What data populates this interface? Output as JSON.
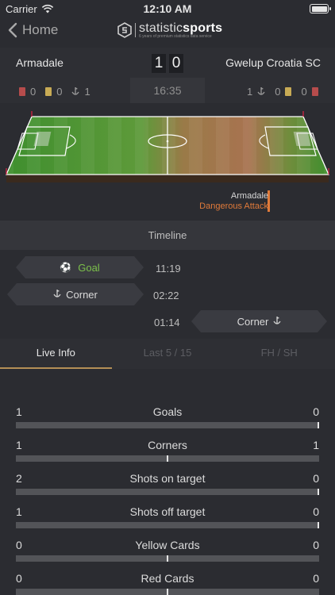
{
  "status": {
    "carrier": "Carrier",
    "time": "12:10 AM"
  },
  "nav": {
    "back_label": "Home",
    "brand_light": "statistic",
    "brand_bold": "sports",
    "tagline": "6 years of premium statistics data service"
  },
  "match": {
    "home_team": "Armadale",
    "away_team": "Gwelup Croatia SC",
    "home_score": "1",
    "away_score": "0",
    "clock": "16:35",
    "home_counts": {
      "red": "0",
      "yellow": "0",
      "corners": "1"
    },
    "away_counts": {
      "corners": "1",
      "yellow": "0",
      "red": "0"
    }
  },
  "event": {
    "team": "Armadale",
    "desc": "Dangerous Attack"
  },
  "timeline": {
    "header": "Timeline",
    "items": [
      {
        "label": "Goal",
        "time": "11:19"
      },
      {
        "label": "Corner",
        "time": "02:22"
      },
      {
        "label": "Corner",
        "time": "01:14"
      }
    ]
  },
  "tabs": [
    "Live Info",
    "Last 5 / 15",
    "FH / SH"
  ],
  "stats": [
    {
      "name": "Goals",
      "home": "1",
      "away": "0",
      "home_share": 1.0
    },
    {
      "name": "Corners",
      "home": "1",
      "away": "1",
      "home_share": 0.5
    },
    {
      "name": "Shots on target",
      "home": "2",
      "away": "0",
      "home_share": 1.0
    },
    {
      "name": "Shots off target",
      "home": "1",
      "away": "0",
      "home_share": 1.0
    },
    {
      "name": "Yellow Cards",
      "home": "0",
      "away": "0",
      "home_share": 0.5
    },
    {
      "name": "Red Cards",
      "home": "0",
      "away": "0",
      "home_share": 0.5
    }
  ],
  "colors": {
    "accent": "#b48f56",
    "attack": "#e07a3a",
    "goal_green": "#7cc04b",
    "red_card": "#c0392b",
    "yellow_card": "#d4b848"
  }
}
